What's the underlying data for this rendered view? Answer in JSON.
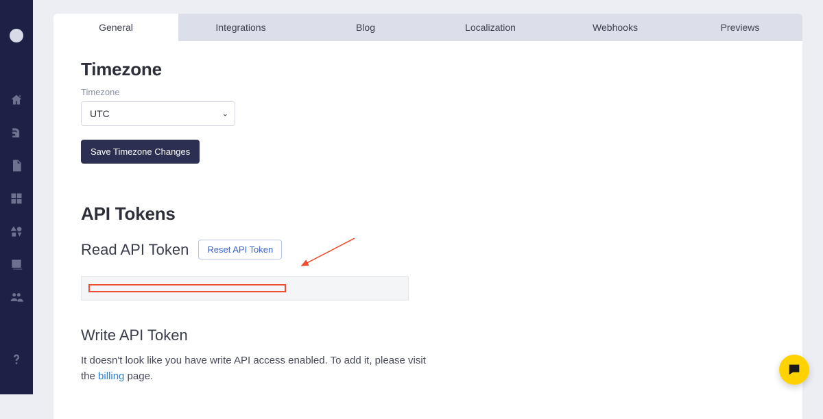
{
  "tabs": {
    "general": "General",
    "integrations": "Integrations",
    "blog": "Blog",
    "localization": "Localization",
    "webhooks": "Webhooks",
    "previews": "Previews"
  },
  "timezone": {
    "heading": "Timezone",
    "field_label": "Timezone",
    "value": "UTC",
    "save_btn": "Save Timezone Changes"
  },
  "api": {
    "heading": "API Tokens",
    "read_heading": "Read API Token",
    "reset_btn": "Reset API Token",
    "write_heading": "Write API Token",
    "write_msg_1": "It doesn't look like you have write API access enabled. To add it, please visit the ",
    "write_link": "billing",
    "write_msg_2": " page."
  }
}
